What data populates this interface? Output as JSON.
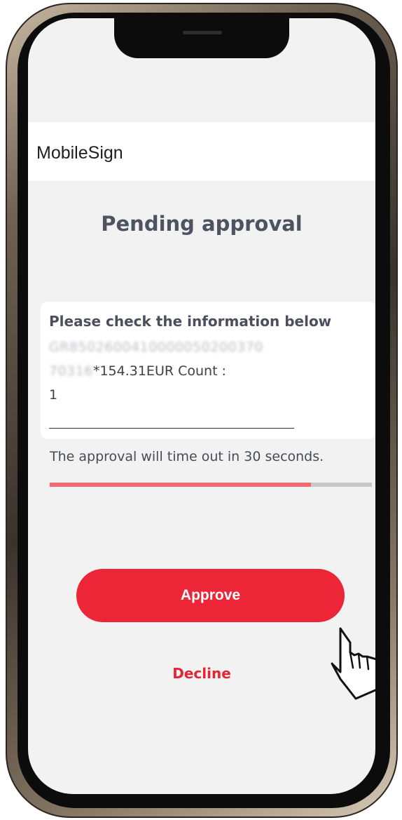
{
  "app": {
    "title": "MobileSign"
  },
  "page": {
    "title": "Pending approval"
  },
  "info_card": {
    "heading": "Please check the information below",
    "iban_line_1": "GR8502600410000050200370",
    "iban_line_2_prefix": "70316",
    "iban_line_2_rest": "*154.31EUR Count :",
    "count_value": "1"
  },
  "timeout": {
    "text": "The approval will time out in 30 seconds.",
    "progress_fraction": 0.81,
    "progress_color": "#ef6b73",
    "track_color": "#c8c8c8"
  },
  "actions": {
    "approve_label": "Approve",
    "decline_label": "Decline",
    "accent_color": "#ec2537"
  },
  "icons": {
    "cursor": "hand-cursor-icon"
  }
}
